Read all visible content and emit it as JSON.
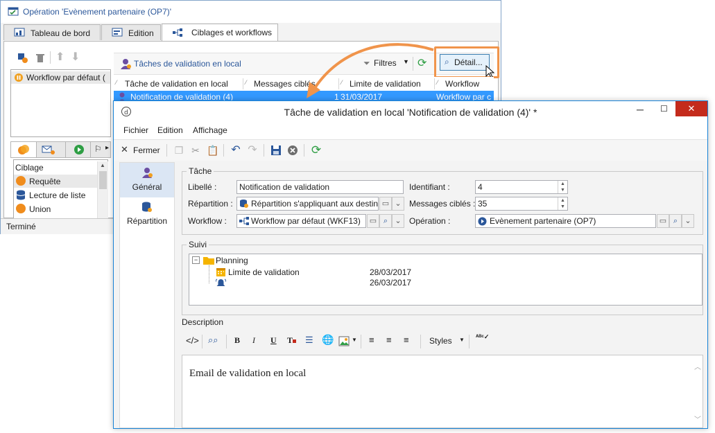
{
  "back_window": {
    "title": "Opération 'Evènement partenaire (OP7)'",
    "tabs": [
      {
        "label": "Tableau de bord"
      },
      {
        "label": "Edition"
      },
      {
        "label": "Ciblages et workflows"
      }
    ],
    "workflow_item": "Workflow par défaut (",
    "left_tabs_list": {
      "header": "Ciblage",
      "items": [
        "Requête",
        "Lecture de liste",
        "Union"
      ]
    },
    "status": "Terminé",
    "task_panel": {
      "title": "Tâches de validation en local",
      "filters_label": "Filtres",
      "detail_button": "Détail...",
      "columns": [
        "Tâche de validation en local",
        "Messages ciblés",
        "Limite de validation",
        "Workflow"
      ],
      "row": {
        "task": "Notification de validation (4)",
        "messages": "1",
        "limit": "31/03/2017",
        "workflow": "Workflow par c"
      }
    }
  },
  "front_window": {
    "title": "Tâche de validation en local 'Notification de validation (4)' *",
    "menu": [
      "Fichier",
      "Edition",
      "Affichage"
    ],
    "toolbar": {
      "close_label": "Fermer"
    },
    "nav": [
      {
        "label": "Général"
      },
      {
        "label": "Répartition"
      }
    ],
    "task_group": {
      "title": "Tâche",
      "libelle_label": "Libellé :",
      "libelle_value": "Notification de validation",
      "repartition_label": "Répartition :",
      "repartition_value": "Répartition s'appliquant aux destin",
      "workflow_label": "Workflow :",
      "workflow_value": "Workflow par défaut (WKF13)",
      "identifiant_label": "Identifiant :",
      "identifiant_value": "4",
      "messages_label": "Messages ciblés :",
      "messages_value": "35",
      "operation_label": "Opération :",
      "operation_value": "Evènement partenaire (OP7)"
    },
    "suivi": {
      "title": "Suivi",
      "planning_label": "Planning",
      "rows": [
        {
          "label": "Limite de validation",
          "date": "28/03/2017"
        },
        {
          "label": "",
          "date": "26/03/2017"
        }
      ]
    },
    "description": {
      "title": "Description",
      "styles_label": "Styles",
      "content": "Email de validation en local"
    }
  },
  "colors": {
    "selection": "#3399ff",
    "accent_blue": "#2b579a",
    "callout_orange": "#f0944b",
    "close_red": "#c42b1c"
  }
}
